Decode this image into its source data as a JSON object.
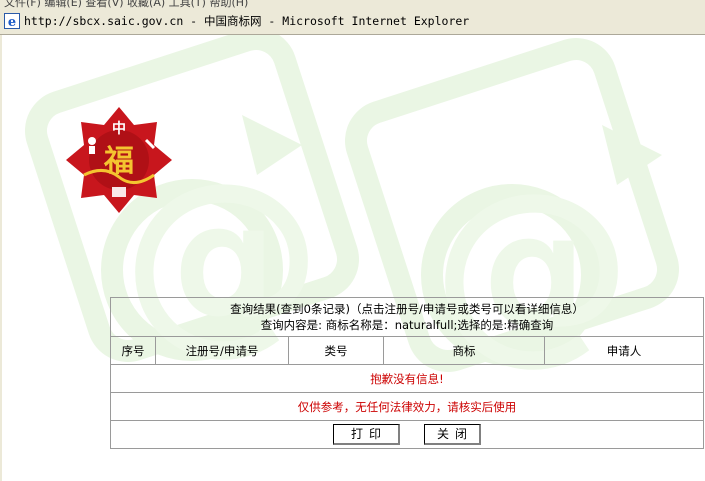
{
  "window": {
    "menu_fragment": "文件(F)  编辑(E)  查看(V)  收藏(A)  工具(T)  帮助(H)",
    "title": "http://sbcx.saic.gov.cn - 中国商标网 - Microsoft Internet Explorer"
  },
  "logo": {
    "top_char": "中",
    "center_char": "福"
  },
  "results": {
    "summary_line1": "查询结果(查到0条记录)（点击注册号/申请号或类号可以看详细信息）",
    "summary_line2": "查询内容是: 商标名称是：naturalfull;选择的是:精确查询",
    "columns": [
      "序号",
      "注册号/申请号",
      "类号",
      "商标",
      "申请人"
    ],
    "empty_message": "抱歉没有信息!",
    "disclaimer": "仅供参考，无任何法律效力，请核实后使用",
    "print_label": "打印",
    "close_label": "关闭"
  },
  "colors": {
    "accent_red": "#cc0000",
    "watermark_green": "#eaf6e4",
    "chrome": "#ece9d8"
  }
}
